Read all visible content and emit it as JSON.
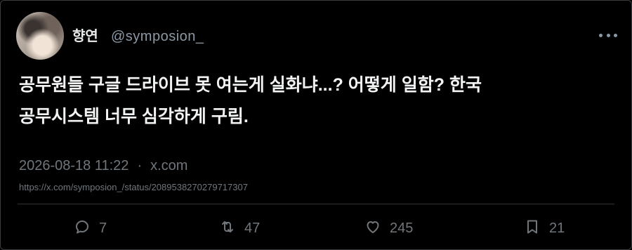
{
  "author": {
    "name": "향연",
    "handle": "@symposion_"
  },
  "tweet": {
    "text_line1": "공무원들 구글 드라이브 못 여는게 실화냐...? 어떻게 일함? 한국",
    "text_line2": "공무시스템 너무 심각하게 구림.",
    "timestamp": "2026-08-18 11:22",
    "separator": "·",
    "source": "x.com",
    "url": "https://x.com/symposion_/status/2089538270279717307"
  },
  "stats": {
    "replies": "7",
    "retweets": "47",
    "likes": "245",
    "bookmarks": "21"
  },
  "colors": {
    "background": "#000000",
    "text_primary": "#e7e9ea",
    "text_secondary": "#71767b",
    "border": "#2f3336"
  },
  "icons": {
    "more": "more-horizontal-icon",
    "reply": "reply-icon",
    "retweet": "retweet-icon",
    "like": "heart-icon",
    "bookmark": "bookmark-icon"
  }
}
